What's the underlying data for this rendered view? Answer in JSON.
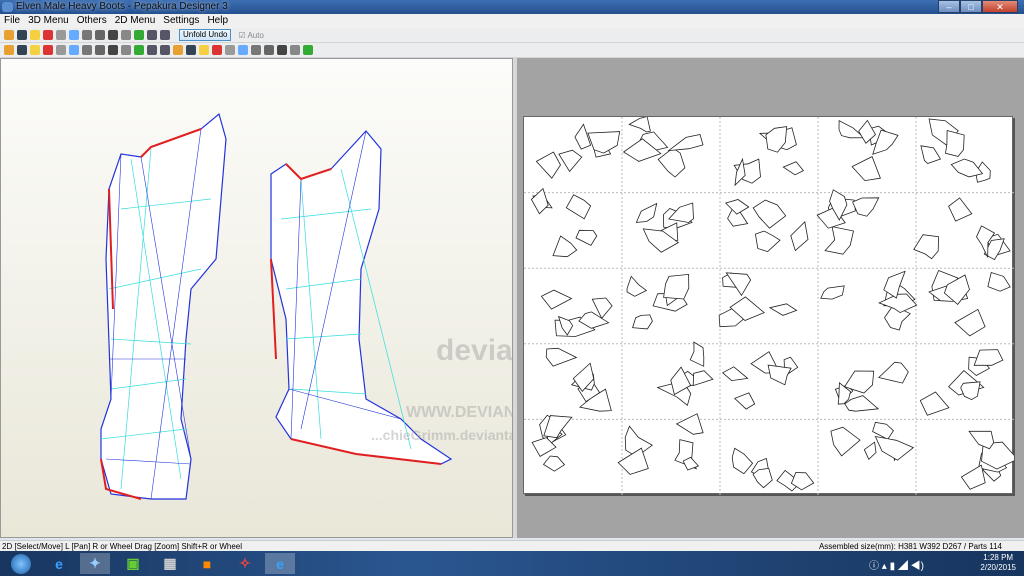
{
  "window": {
    "title": "Elven Male Heavy Boots - Pepakura Designer 3",
    "minimize": "–",
    "maximize": "□",
    "close": "✕"
  },
  "menu": [
    "File",
    "3D Menu",
    "Others",
    "2D Menu",
    "Settings",
    "Help"
  ],
  "toolbar": {
    "unfold_undo": "Unfold Undo",
    "auto_label": "Auto",
    "auto_checked": true
  },
  "watermark": {
    "logo": "deviantart",
    "url": "WWW.DEVIANTART.COM",
    "user": "...chieGrimm.deviantart.com"
  },
  "status": {
    "left": "2D [Select/Move] L [Pan] R or Wheel Drag [Zoom] Shift+R or Wheel",
    "right": "Assembled size(mm): H381 W392 D267 / Parts 114"
  },
  "taskbar": {
    "time": "1:28 PM",
    "date": "2/20/2015",
    "apps": [
      "start-orb",
      "internet-explorer",
      "pepakura",
      "gimp",
      "media-app",
      "file-app",
      "3d-app",
      "internet-explorer-active"
    ]
  },
  "colors": {
    "edge_blue": "#2233dd",
    "edge_red": "#e02020",
    "fold_cyan": "#33dddd"
  }
}
